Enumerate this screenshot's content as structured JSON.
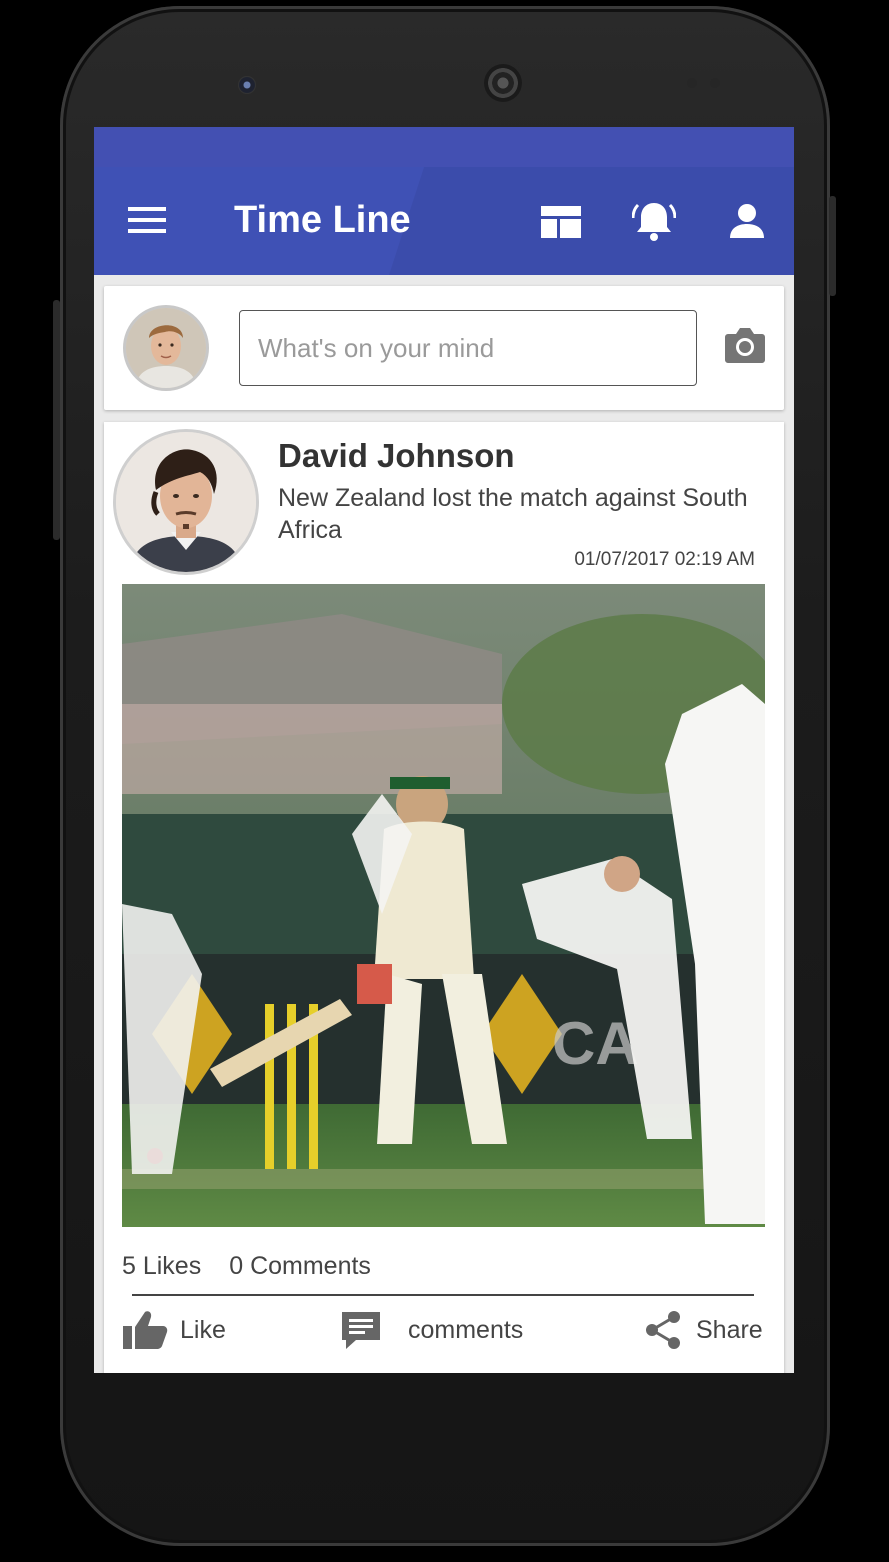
{
  "appbar": {
    "title": "Time Line",
    "icons": [
      "menu-icon",
      "view-dashboard-icon",
      "notification-bell-icon",
      "account-icon"
    ],
    "color": "#3f51b5"
  },
  "composer": {
    "placeholder": "What's on your mind",
    "icon": "camera-icon"
  },
  "post": {
    "author": "David Johnson",
    "text": "New Zealand lost the match against South Africa",
    "timestamp": "01/07/2017 02:19 AM",
    "likes_text": "5 Likes",
    "comments_text": "0 Comments",
    "actions": {
      "like": "Like",
      "comments": "comments",
      "share": "Share"
    }
  }
}
